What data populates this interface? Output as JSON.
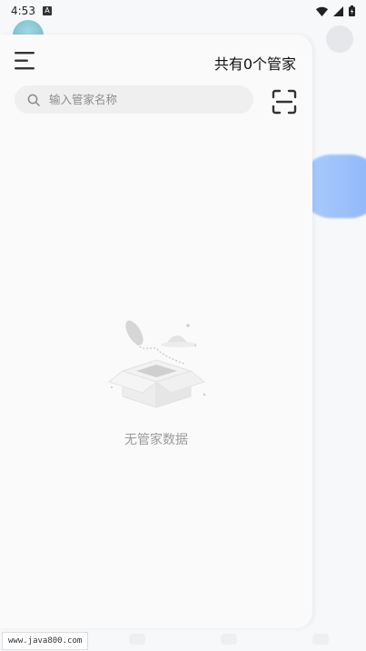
{
  "status_bar": {
    "time": "4:53",
    "notification_letter": "A"
  },
  "drawer": {
    "count_text": "共有0个管家",
    "search": {
      "placeholder": "输入管家名称",
      "value": ""
    },
    "empty_text": "无管家数据"
  },
  "watermark": "www.java800.com"
}
